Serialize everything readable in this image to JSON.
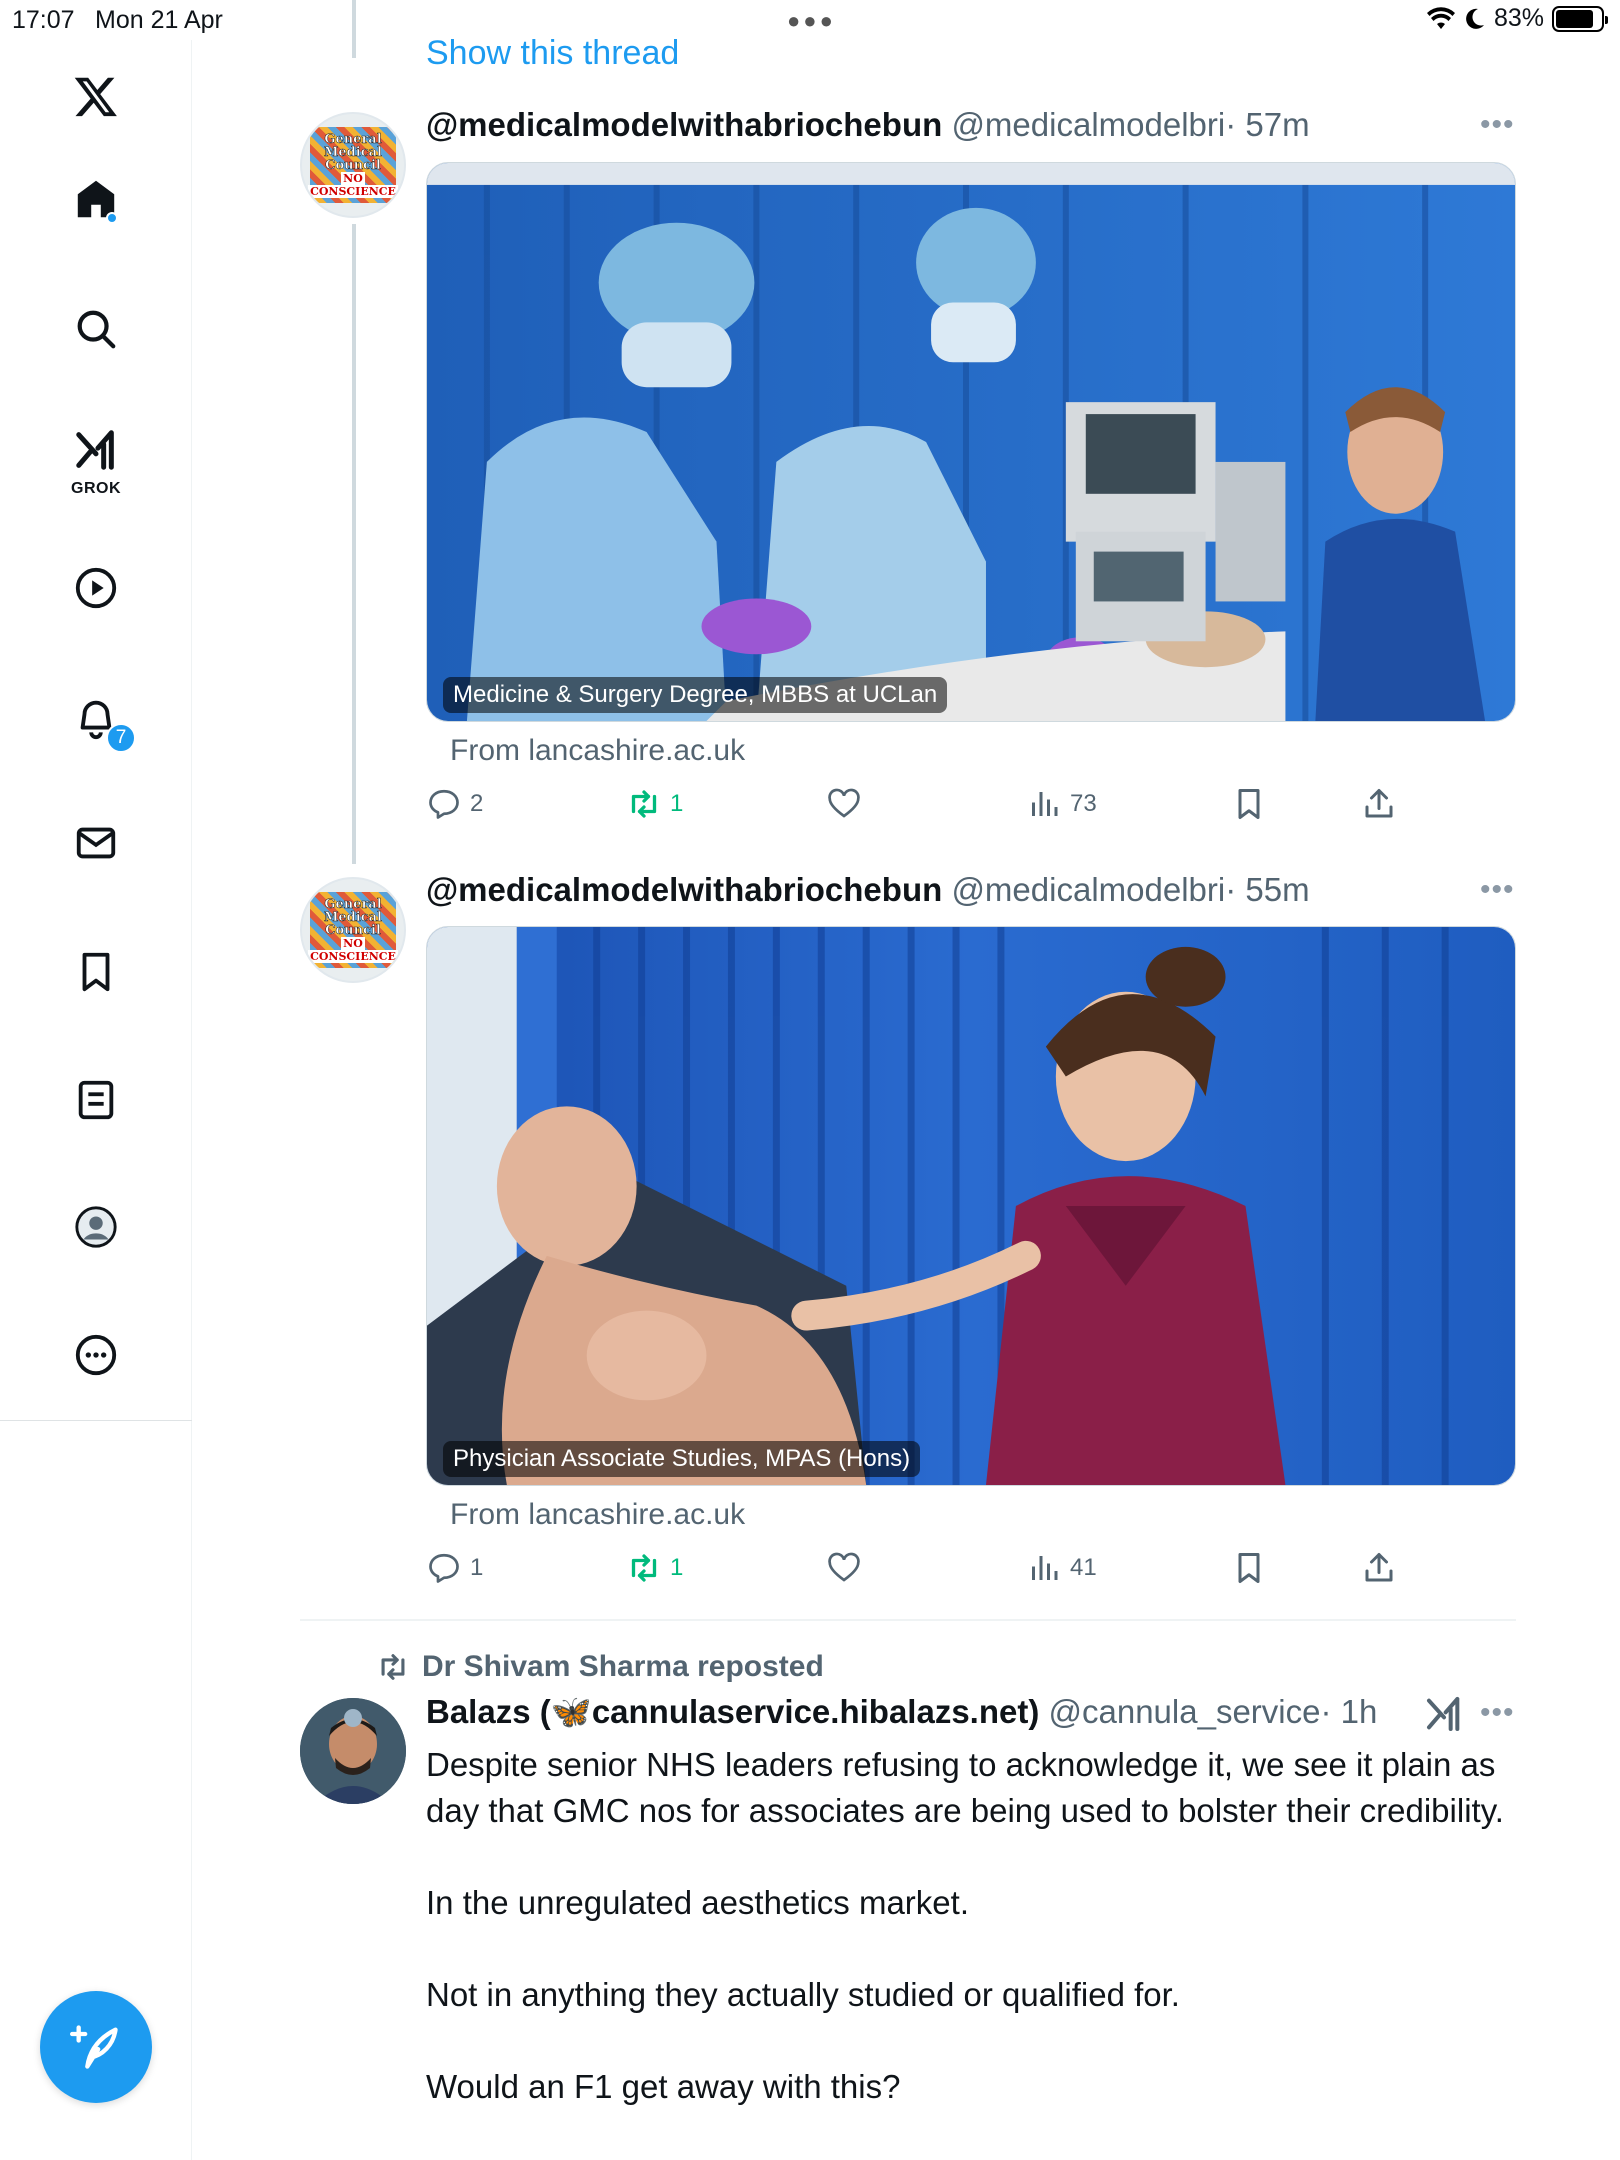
{
  "status_bar": {
    "time": "17:07",
    "date": "Mon 21 Apr",
    "battery": "83%"
  },
  "sidebar": {
    "grok_label": "GROK",
    "notifications_badge": "7",
    "icons": [
      "x-logo-icon",
      "home-icon",
      "search-icon",
      "grok-icon",
      "video-icon",
      "notifications-icon",
      "messages-icon",
      "bookmarks-icon",
      "lists-icon",
      "profile-icon",
      "more-icon"
    ]
  },
  "thread": {
    "show_thread_label": "Show this thread"
  },
  "tweets": [
    {
      "display_name": "@medicalmodelwithabriochebun",
      "handle": "@medicalmodelbri",
      "time": "· 57m",
      "avatar_text": [
        "General",
        "Medical",
        "Council"
      ],
      "avatar_sub": [
        "NO",
        "CONSCIENCE"
      ],
      "media_caption": "Medicine & Surgery Degree, MBBS at UCLan",
      "source": "From lancashire.ac.uk",
      "replies": "2",
      "reposts": "1",
      "views": "73"
    },
    {
      "display_name": "@medicalmodelwithabriochebun",
      "handle": "@medicalmodelbri",
      "time": "· 55m",
      "avatar_text": [
        "General",
        "Medical",
        "Council"
      ],
      "avatar_sub": [
        "NO",
        "CONSCIENCE"
      ],
      "media_caption": "Physician Associate Studies, MPAS (Hons)",
      "source": "From lancashire.ac.uk",
      "replies": "1",
      "reposts": "1",
      "views": "41"
    }
  ],
  "repost": {
    "reposted_by": "Dr Shivam Sharma reposted",
    "display_name_prefix": "Balazs (",
    "display_name_emoji": "🦋",
    "display_name_suffix": "cannulaservice.hibalazs.net)",
    "handle": "@cannula_service",
    "time": "· 1h",
    "paragraphs": [
      "Despite senior NHS leaders refusing to acknowledge it, we see it plain as day that GMC nos for associates are being used to bolster their credibility.",
      "In the unregulated aesthetics market.",
      "Not in anything they actually studied or qualified for.",
      "Would an F1 get away with this?"
    ]
  },
  "colors": {
    "accent": "#1d9bf0",
    "repost_green": "#00ba7c",
    "muted": "#536471"
  }
}
